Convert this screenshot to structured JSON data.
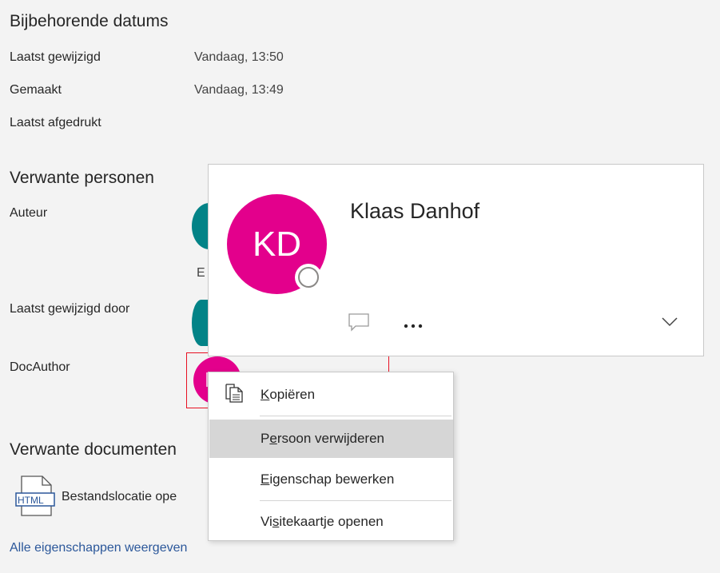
{
  "dates": {
    "title": "Bijbehorende datums",
    "rows": [
      {
        "label": "Laatst gewijzigd",
        "value": "Vandaag, 13:50"
      },
      {
        "label": "Gemaakt",
        "value": "Vandaag, 13:49"
      },
      {
        "label": "Laatst afgedrukt",
        "value": ""
      }
    ]
  },
  "people": {
    "title": "Verwante personen",
    "author_label": "Auteur",
    "author_partial_text": "E",
    "last_modified_by_label": "Laatst gewijzigd door",
    "docauthor_label": "DocAuthor"
  },
  "documents": {
    "title": "Verwante documenten",
    "file_icon_text": "HTML",
    "open_location_label": "Bestandslocatie ope"
  },
  "footer": {
    "all_properties_link": "Alle eigenschappen weergeven"
  },
  "contact_card": {
    "initials": "KD",
    "name": "Klaas Danhof",
    "avatar_color": "#e3008c"
  },
  "context_menu": {
    "items": [
      {
        "pre": "",
        "accel": "K",
        "post": "opiëren"
      },
      {
        "pre": "P",
        "accel": "e",
        "post": "rsoon verwijderen"
      },
      {
        "pre": "",
        "accel": "E",
        "post": "igenschap bewerken"
      },
      {
        "pre": "Vi",
        "accel": "s",
        "post": "itekaartje openen"
      }
    ]
  },
  "colors": {
    "teal_avatar": "#038387",
    "link": "#2b579a",
    "focus_border": "#e81123"
  }
}
